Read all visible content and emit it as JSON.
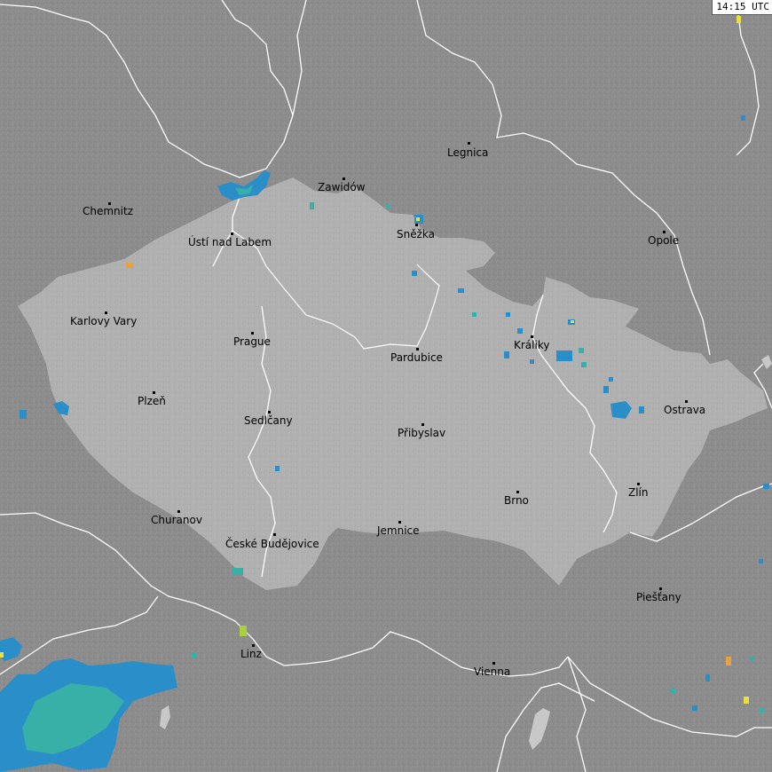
{
  "timestamp": "14:15 UTC",
  "colors": {
    "background": "#8e8e8e",
    "highlight_country": "#b0b0b0",
    "border": "#ffffff",
    "water": "#c8c8c8",
    "radar_light": "#2a8ec8",
    "radar_medium": "#38b0a8",
    "radar_strong": "#e8e040",
    "lightning_orange": "#e8a040"
  },
  "cities": [
    "Chemnitz",
    "Zawidów",
    "Legnica",
    "Ústí nad Labem",
    "Sněžka",
    "Opole",
    "Karlovy Vary",
    "Prague",
    "Pardubice",
    "Králiky",
    "Plzeň",
    "Sedlčany",
    "Přibyslav",
    "Ostrava",
    "Zlín",
    "Brno",
    "Churanov",
    "České Budějovice",
    "Jemnice",
    "Piešťany",
    "Linz",
    "Vienna"
  ]
}
